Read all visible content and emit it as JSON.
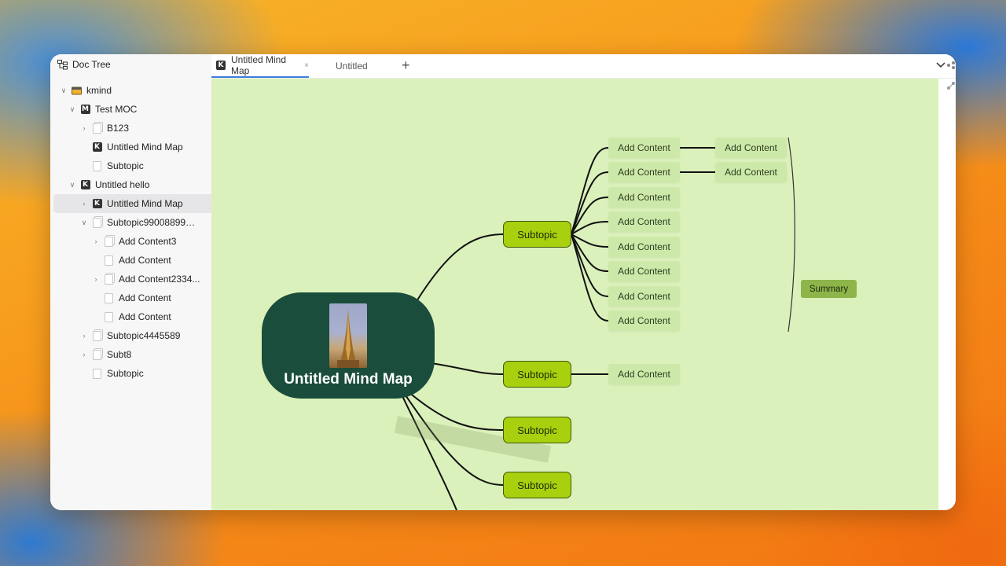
{
  "sidebar": {
    "title": "Doc Tree",
    "items": [
      {
        "label": "kmind",
        "icon": "box-icon"
      },
      {
        "label": "Test MOC",
        "icon": "m-icon"
      },
      {
        "label": "B123",
        "icon": "doc-stack-icon"
      },
      {
        "label": "Untitled Mind Map",
        "icon": "k-icon"
      },
      {
        "label": "Subtopic",
        "icon": "doc-icon"
      },
      {
        "label": "Untitled hello",
        "icon": "k-icon"
      },
      {
        "label": "Untitled Mind Map",
        "icon": "k-icon"
      },
      {
        "label": "Subtopic99008899553",
        "icon": "doc-stack-icon"
      },
      {
        "label": "Add Content3",
        "icon": "doc-stack-icon"
      },
      {
        "label": "Add Content",
        "icon": "doc-icon"
      },
      {
        "label": "Add Content2334...",
        "icon": "doc-stack-icon"
      },
      {
        "label": "Add Content",
        "icon": "doc-icon"
      },
      {
        "label": "Add Content",
        "icon": "doc-icon"
      },
      {
        "label": "Subtopic4445589",
        "icon": "doc-stack-icon"
      },
      {
        "label": "Subt8",
        "icon": "doc-stack-icon"
      },
      {
        "label": "Subtopic",
        "icon": "doc-icon"
      }
    ]
  },
  "tabs": [
    {
      "label": "Untitled Mind Map",
      "icon": "k-icon",
      "close": "×"
    },
    {
      "label": "Untitled"
    }
  ],
  "mindmap": {
    "root": "Untitled Mind Map",
    "subtopics": [
      "Subtopic",
      "Subtopic",
      "Subtopic",
      "Subtopic"
    ],
    "contents": [
      "Add Content",
      "Add Content",
      "Add Content",
      "Add Content",
      "Add Content",
      "Add Content",
      "Add Content",
      "Add Content"
    ],
    "sub_contents": [
      "Add Content",
      "Add Content"
    ],
    "second_content": "Add Content",
    "summary": "Summary"
  },
  "colors": {
    "canvas": "#dbf1bb",
    "root_node": "#1a4d3b",
    "subtopic": "#a9d00e",
    "content": "#cde9a9",
    "summary": "#8db54a",
    "active_tab": "#3b7ddd"
  }
}
